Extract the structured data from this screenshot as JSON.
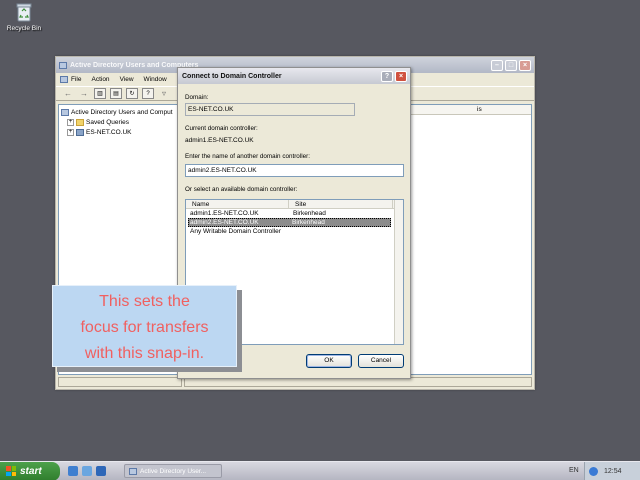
{
  "desktop": {
    "recycle_bin_label": "Recycle Bin"
  },
  "mmc": {
    "title": "Active Directory Users and Computers",
    "menu": [
      "File",
      "Action",
      "View",
      "Window"
    ],
    "tree": {
      "root": "Active Directory Users and Comput",
      "children": [
        "Saved Queries",
        "ES-NET.CO.UK"
      ]
    },
    "right_header_fragment": "is"
  },
  "dialog": {
    "title": "Connect to Domain Controller",
    "domain_label": "Domain:",
    "domain_value": "ES-NET.CO.UK",
    "current_dc_label": "Current domain controller:",
    "current_dc_value": "admin1.ES-NET.CO.UK",
    "enter_label": "Enter the name of another domain controller:",
    "enter_value": "admin2.ES-NET.CO.UK",
    "select_label": "Or select an available domain controller:",
    "columns": {
      "name": "Name",
      "site": "Site"
    },
    "rows": [
      {
        "name": "admin1.ES-NET.CO.UK",
        "site": "Birkenhead"
      },
      {
        "name": "admin2.ES-NET.CO.UK",
        "site": "Birkenhead"
      },
      {
        "name": "Any Writable Domain Controller",
        "site": ""
      }
    ],
    "selected_row": 1,
    "ok_label": "OK",
    "cancel_label": "Cancel"
  },
  "caption": {
    "line1": "This sets the",
    "line2": "focus for transfers",
    "line3": "with this snap-in."
  },
  "taskbar": {
    "start_label": "start",
    "task_label": "Active Directory User...",
    "language": "EN",
    "clock": "12:54"
  },
  "colors": {
    "desktop_bg": "#575860",
    "caption_bg": "#bcd7f2",
    "caption_text": "#f06060",
    "selected_row": "#8c8c8c",
    "start_green": "#3a8c37"
  }
}
